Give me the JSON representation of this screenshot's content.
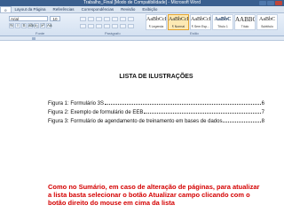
{
  "window": {
    "title": "Trabalho_Final [Modo de Compatibilidade] - Microsoft Word"
  },
  "ribbon": {
    "tabs": [
      "o",
      "Layout da Página",
      "Referências",
      "Correspondências",
      "Revisão",
      "Exibição"
    ],
    "active_tab": "o",
    "font_name": "Arial",
    "font_size": "10",
    "format_buttons": [
      "N",
      "I",
      "S",
      "abc",
      "x₂",
      "x²",
      "Aa"
    ],
    "styles": [
      {
        "sample": "AaBbCcI",
        "label": "¶ Legenda"
      },
      {
        "sample": "AaBbCcI",
        "label": "¶ Normal"
      },
      {
        "sample": "AaBbCcI",
        "label": "¶ Sem Esp..."
      },
      {
        "sample": "AaBbC",
        "label": "Título 1"
      },
      {
        "sample": "AABBC",
        "label": "Título"
      },
      {
        "sample": "AaBbC",
        "label": "Subtítulo"
      }
    ],
    "groups": {
      "font": "Fonte",
      "paragraph": "Parágrafo",
      "styles": "Estilo"
    }
  },
  "document": {
    "heading": "LISTA DE ILUSTRAÇÕES",
    "toc_entries": [
      {
        "text": "Figura 1: Formulário 3S",
        "page": "6"
      },
      {
        "text": "Figura 2: Exemplo de formulário de EEB",
        "page": "7"
      },
      {
        "text": "Figura 3: Formulário de agendamento de treinamento em bases de dados",
        "page": "8"
      }
    ],
    "note": "Como no Sumário, em caso de alteração de páginas, para atualizar a lista basta selecionar o botão Atualizar campo clicando com o botão direito do mouse em cima da lista"
  }
}
